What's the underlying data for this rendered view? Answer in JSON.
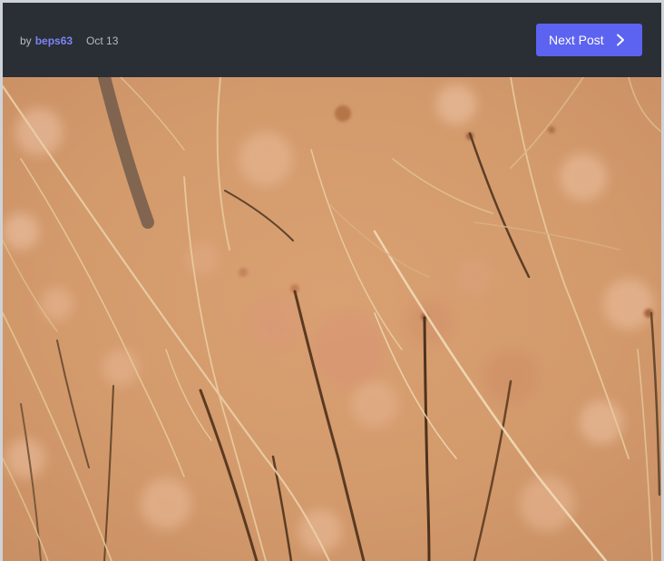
{
  "post": {
    "by_label": "by",
    "author": "beps63",
    "date": "Oct 13"
  },
  "navigation": {
    "next_label": "Next Post",
    "next_icon": "chevron-right-icon"
  },
  "image": {
    "subject": "magnified skin with hairs",
    "colors": {
      "skin_base": "#d69a6f",
      "skin_light": "#e8b898",
      "hair_dark": "#5a3a22",
      "hair_light": "#e7c79a"
    }
  },
  "colors": {
    "header_bg": "#2a2e35",
    "accent": "#5c63f0",
    "author_link": "#7c85f5",
    "meta_text": "#b5bac2"
  }
}
